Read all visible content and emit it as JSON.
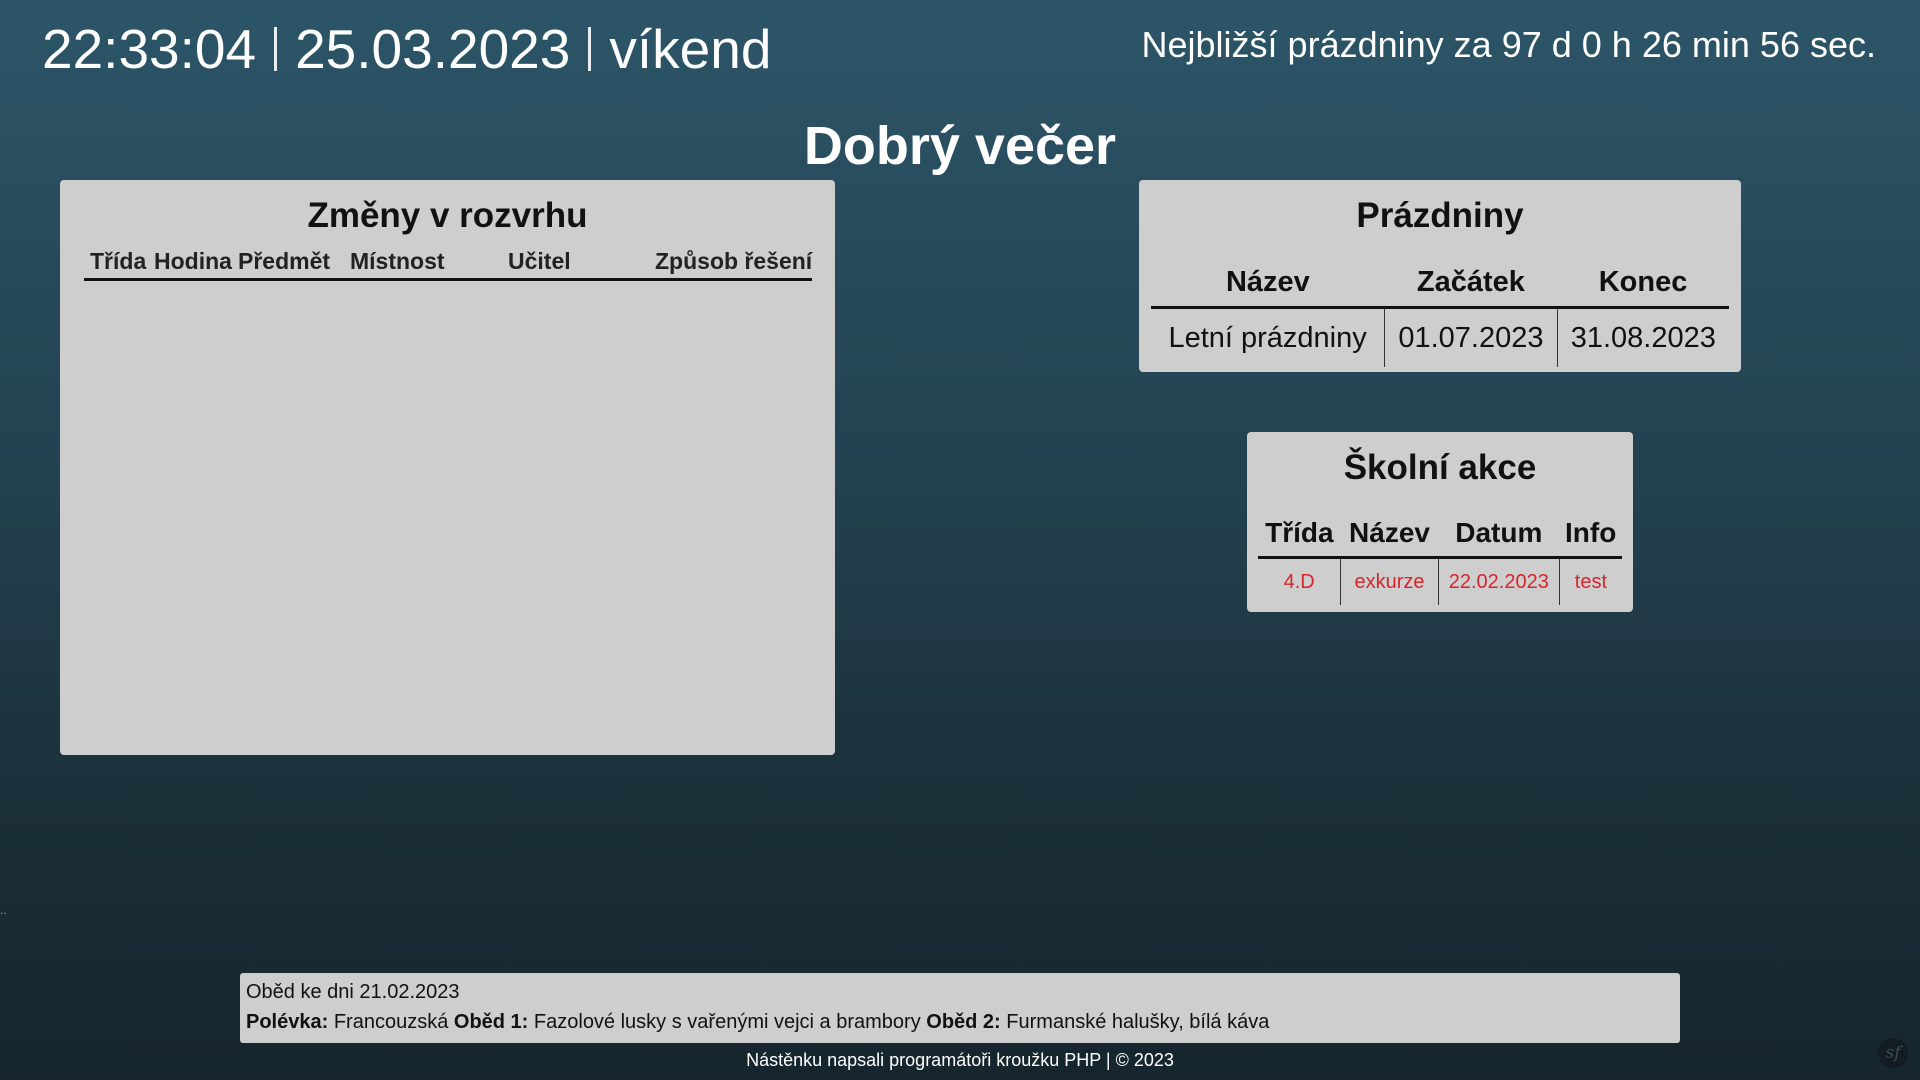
{
  "header": {
    "time": "22:33:04",
    "date": "25.03.2023",
    "day_type": "víkend",
    "countdown": {
      "prefix": "Nejbližší prázdniny za",
      "days": "97 d",
      "hours": "0 h",
      "minutes": "26 min",
      "seconds": "56 sec."
    }
  },
  "greeting": "Dobrý večer",
  "schedule_changes": {
    "title": "Změny v rozvrhu",
    "columns": [
      "Třída",
      "Hodina",
      "Předmět",
      "Místnost",
      "Učitel",
      "Způsob řešení"
    ],
    "rows": []
  },
  "holidays": {
    "title": "Prázdniny",
    "columns": [
      "Název",
      "Začátek",
      "Konec"
    ],
    "rows": [
      {
        "name": "Letní prázdniny",
        "start": "01.07.2023",
        "end": "31.08.2023"
      }
    ]
  },
  "school_events": {
    "title": "Školní akce",
    "columns": [
      "Třída",
      "Název",
      "Datum",
      "Info"
    ],
    "rows": [
      {
        "class": "4.D",
        "name": "exkurze",
        "date": "22.02.2023",
        "info": "test"
      }
    ],
    "row_color": "#d8242b"
  },
  "lunch": {
    "date_line": "Oběd ke dni 21.02.2023",
    "soup_label": "Polévka:",
    "soup": "Francouzská",
    "meal1_label": "Oběd 1:",
    "meal1": "Fazolové lusky s vařenými vejci a brambory",
    "meal2_label": "Oběd 2:",
    "meal2": "Furmanské halušky, bílá káva"
  },
  "footer": "Nástěnku napsali programátoři kroužku PHP | © 2023",
  "icons": {
    "symfony": "sf"
  },
  "stray_text": ".."
}
